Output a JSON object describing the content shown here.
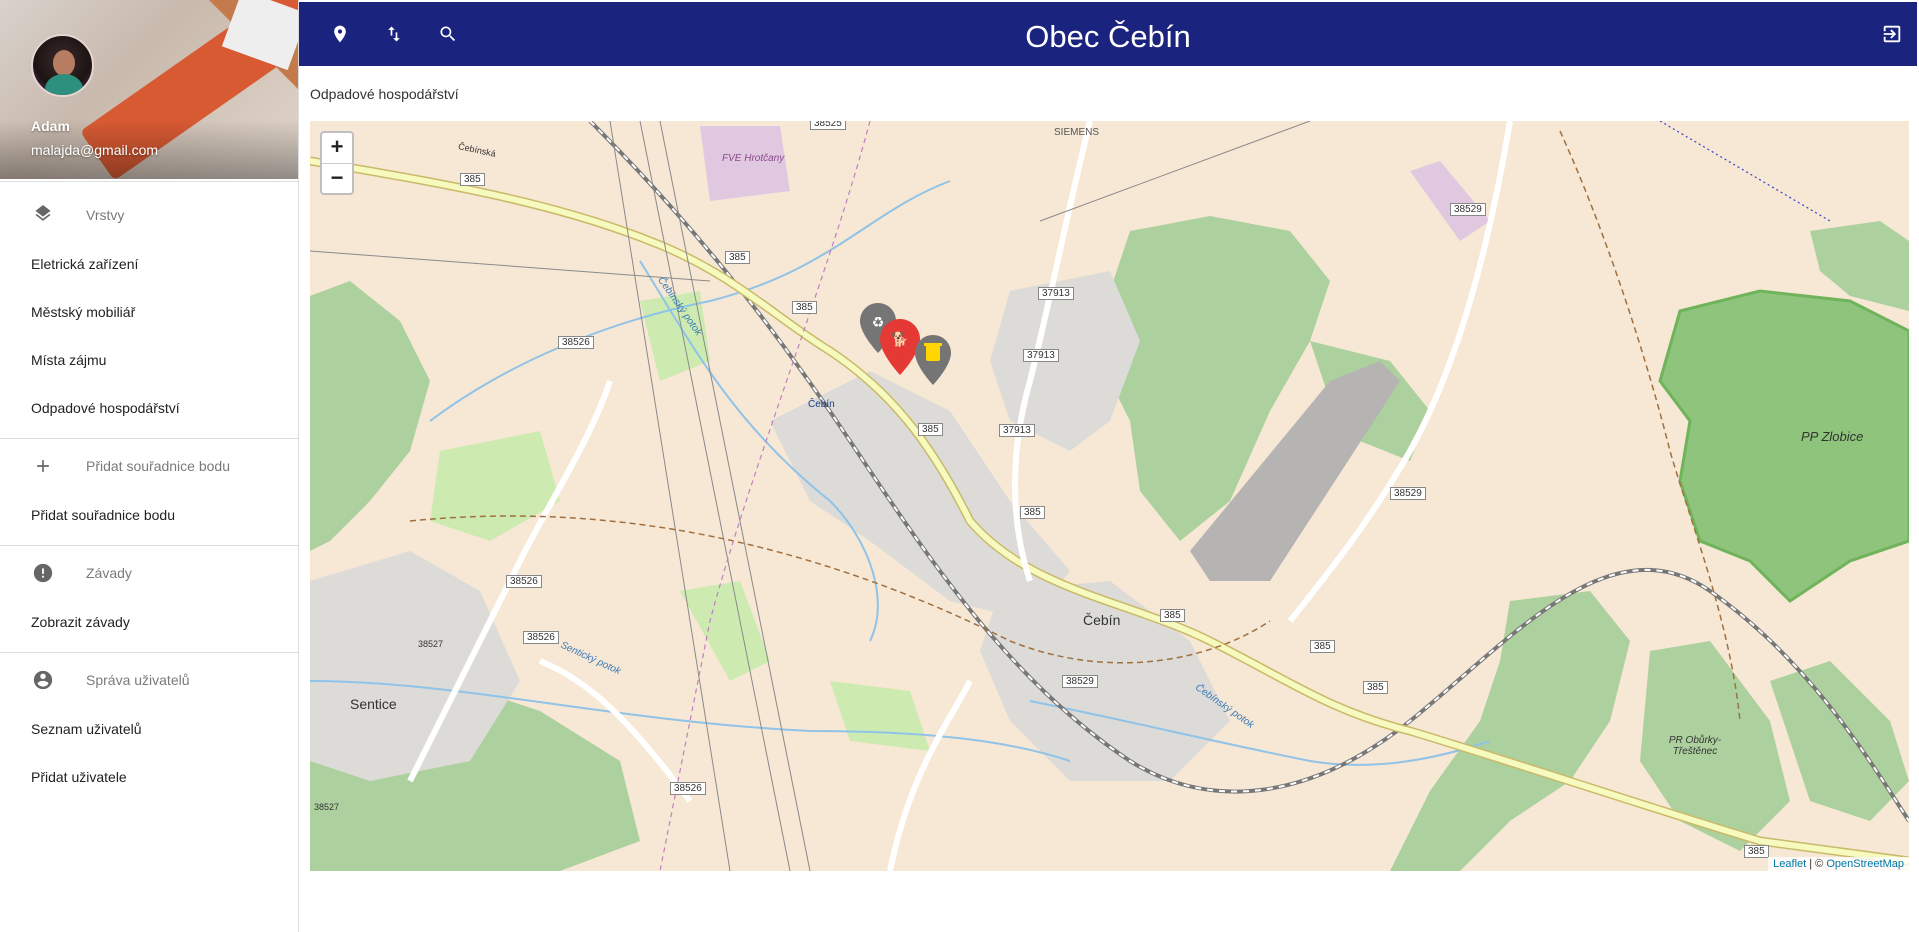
{
  "app_title": "Obec Čebín",
  "user": {
    "name": "Adam",
    "email": "malajda@gmail.com"
  },
  "section_title": "Odpadové hospodářství",
  "sidebar": {
    "sections": [
      {
        "header": "Vrstvy",
        "icon": "layers-icon",
        "items": [
          "Eletrická zařízení",
          "Městský mobiliář",
          "Místa zájmu",
          "Odpadové hospodářství"
        ]
      },
      {
        "header": "Přidat souřadnice bodu",
        "icon": "plus-icon",
        "items": [
          "Přidat souřadnice bodu"
        ]
      },
      {
        "header": "Závady",
        "icon": "alert-icon",
        "items": [
          "Zobrazit závady"
        ]
      },
      {
        "header": "Správa uživatelů",
        "icon": "account-circle-icon",
        "items": [
          "Seznam uživatelů",
          "Přidat uživatele"
        ]
      }
    ]
  },
  "topbar": {
    "icons": [
      "map-marker-icon",
      "sort-arrows-icon",
      "search-icon"
    ],
    "right_icon": "logout-icon"
  },
  "map": {
    "zoom_in": "+",
    "zoom_out": "−",
    "attribution": {
      "leaflet": "Leaflet",
      "sep": " | © ",
      "osm": "OpenStreetMap"
    },
    "place_labels": {
      "cebin": "Čebín",
      "cebin_station": "Čebín",
      "sentice": "Sentice",
      "siemens": "SIEMENS",
      "fve": "FVE Hrotčany",
      "zlobice": "PP Zlobice",
      "oburky": "PR Obůrky-Třeštěnec",
      "cebinsky_potok_1": "Čebínský potok",
      "cebinsky_potok_2": "Čebínský potok",
      "senticky_potok": "Sentický potok",
      "cebinska": "Čebínská"
    },
    "road_numbers": [
      "385",
      "38526",
      "37913",
      "38529",
      "38525",
      "38527"
    ]
  },
  "colors": {
    "topbar": "#1a237e",
    "marker_red": "#e53935",
    "marker_grey": "#757575",
    "bin_yellow": "#ffd600"
  }
}
